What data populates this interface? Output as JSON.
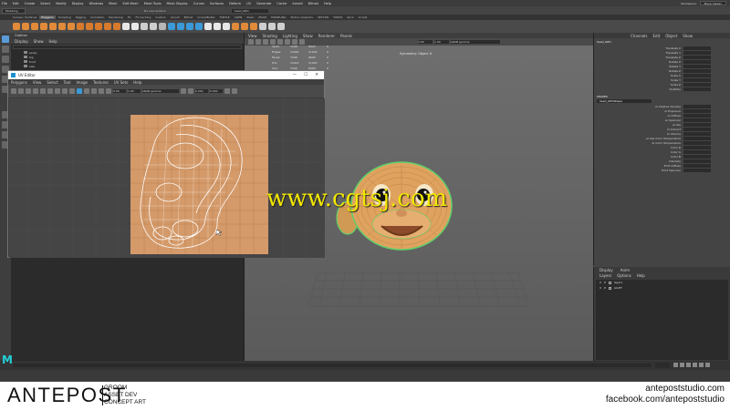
{
  "app": {
    "menu": [
      "File",
      "Edit",
      "Create",
      "Select",
      "Modify",
      "Display",
      "Windows",
      "Mesh",
      "Edit Mesh",
      "Mesh Tools",
      "Mesh Display",
      "Curves",
      "Surfaces",
      "Deform",
      "UV",
      "Generate",
      "Cache",
      "Arnold",
      "Bifrost",
      "Help"
    ],
    "workspace_label": "Workspace:",
    "workspace_value": "Maya Classic",
    "menuset": "Modeling",
    "live_surface": "No Live Surface",
    "object_field": "head_GEO",
    "shelf_tabs": [
      "Curves / Surfaces",
      "Polygons",
      "Sculpting",
      "Rigging",
      "Animation",
      "Rendering",
      "FX",
      "FX Caching",
      "Custom",
      "Arnold",
      "Bifrost",
      "Crowd/Bullet",
      "TURTLE",
      "XGEN",
      "XGen",
      "MASH",
      "MODELING",
      "Motion Graphics",
      "VECTOR",
      "TOPOS",
      "Rock",
      "Arnold"
    ],
    "active_shelf_tab": "Polygons"
  },
  "outliner": {
    "title": "Outliner",
    "menu": [
      "Display",
      "Show",
      "Help"
    ],
    "items": [
      "persp",
      "top",
      "front",
      "side"
    ]
  },
  "uv_editor": {
    "title": "UV Editor",
    "menu": [
      "Polygons",
      "View",
      "Select",
      "Tool",
      "Image",
      "Textures",
      "UV Sets",
      "Help"
    ],
    "field_a": "0.00",
    "field_b": "1.00",
    "field_c": "0.000",
    "field_d": "0.000",
    "color_mode": "sRGB gamma",
    "controls": {
      "min": "—",
      "max": "☐",
      "close": "✕"
    }
  },
  "viewport": {
    "menu": [
      "View",
      "Shading",
      "Lighting",
      "Show",
      "Renderer",
      "Panels"
    ],
    "label": "Symmetry: Object X",
    "camera": "persp",
    "field_a": "0.00",
    "field_b": "1.00",
    "color_mode": "sRGB gamma",
    "stats": [
      {
        "label": "Verts:",
        "v1": "7298",
        "v2": "9625",
        "v3": "0"
      },
      {
        "label": "Edges:",
        "v1": "14452",
        "v2": "11024",
        "v3": "0"
      },
      {
        "label": "Faces:",
        "v1": "7208",
        "v2": "9600",
        "v3": "0"
      },
      {
        "label": "Tris:",
        "v1": "14412",
        "v2": "11024",
        "v3": "0"
      },
      {
        "label": "UVs:",
        "v1": "7440",
        "v2": "8400",
        "v3": "0"
      }
    ]
  },
  "attribute_editor": {
    "tabs": [
      "Channels",
      "Edit",
      "Object",
      "Show"
    ],
    "object": "head_GEO",
    "channels": [
      "Translate X",
      "Translate Y",
      "Translate Z",
      "Rotate X",
      "Rotate Y",
      "Rotate Z",
      "Scale X",
      "Scale Y",
      "Scale Z",
      "Visibility"
    ],
    "shapes_head": "SHAPES",
    "shape_name": "head_GEOShape",
    "shape_attrs": [
      "Ai Shadow Density",
      "Ai Exposure",
      "Ai Diffuse",
      "Ai Specular",
      "Ai Sss",
      "Ai Indirect",
      "Ai Volume",
      "Ai Use Color Temperature",
      "Ai Color Temperature",
      "Color R",
      "Color G",
      "Color B",
      "Intensity",
      "Emit Diffuse",
      "Emit Specular"
    ]
  },
  "layer_editor": {
    "tabs": [
      "Display",
      "Anim"
    ],
    "menu": [
      "Layers",
      "Options",
      "Help"
    ],
    "layers": [
      {
        "v": "V",
        "p": "P",
        "name": "layer1"
      },
      {
        "v": "V",
        "p": "P",
        "name": "LIGHT"
      }
    ]
  },
  "watermark": "www.cgtsj.com",
  "footer": {
    "brand": "ANTEPOST",
    "tags": [
      "GROOM",
      "ASSET DEV",
      "CONCEPT ART"
    ],
    "site": "antepoststudio.com",
    "facebook": "facebook.com/antepoststudio"
  },
  "colors": {
    "uv_tile": "#d49a6a",
    "mesh_green": "#5fd06a",
    "mesh_orange": "#e0a25f",
    "watermark": "#f2e600",
    "maya_logo": "#22d0d8"
  }
}
